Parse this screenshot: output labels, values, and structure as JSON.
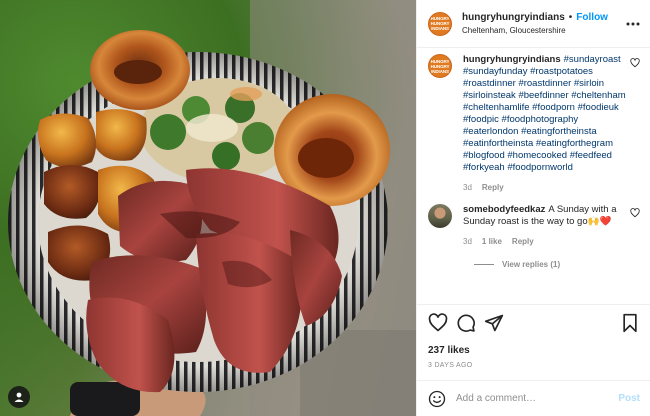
{
  "post": {
    "username": "hungryhungryindians",
    "follow_label": "Follow",
    "separator": "•",
    "location": "Cheltenham, Gloucestershire",
    "more_icon": "more-horizontal-icon",
    "logo_text": "HUNGRY HUNGRY INDIANS"
  },
  "caption": {
    "username": "hungryhungryindians",
    "text": "#sundayroast #sundayfunday #roastpotatoes #roastdinner #roastdinner #sirloin #sirloinsteak #beefdinner #cheltenham #cheltenhamlife #foodporn #foodieuk #foodpic #foodphotography #eaterlondon #eatingfortheinsta #eatinfortheinsta #eatingforthegram #blogfood #homecooked #feedfeed #forkyeah #foodpornworld",
    "time": "3d",
    "reply_label": "Reply"
  },
  "comment": {
    "username": "somebodyfeedkaz",
    "text": "A Sunday with a Sunday roast is the way to go🙌❤️",
    "time": "3d",
    "likes": "1 like",
    "reply_label": "Reply",
    "view_replies": "View replies (1)"
  },
  "actions": {
    "likes": "237 likes",
    "date": "3 DAYS AGO",
    "icons": [
      "heart-icon",
      "comment-icon",
      "share-icon",
      "bookmark-icon"
    ]
  },
  "add_comment": {
    "placeholder": "Add a comment…",
    "post_label": "Post"
  },
  "colors": {
    "link_blue": "#0095f6",
    "hashtag_blue": "#00376b",
    "muted": "#8e8e8e",
    "post_disabled": "#b2dffc",
    "brand_orange": "#e07a21"
  }
}
